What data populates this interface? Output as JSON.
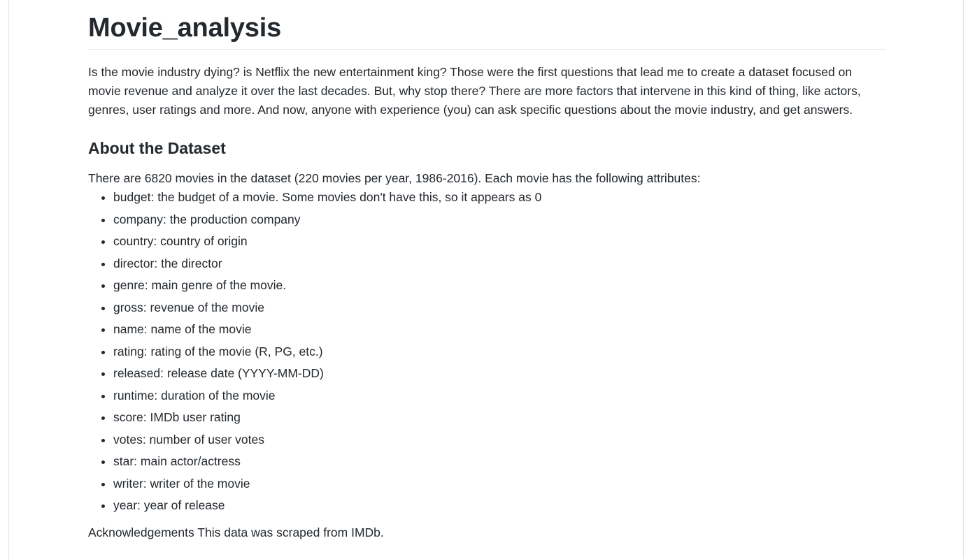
{
  "document": {
    "title": "Movie_analysis",
    "intro": "Is the movie industry dying? is Netflix the new entertainment king? Those were the first questions that lead me to create a dataset focused on movie revenue and analyze it over the last decades. But, why stop there? There are more factors that intervene in this kind of thing, like actors, genres, user ratings and more. And now, anyone with experience (you) can ask specific questions about the movie industry, and get answers.",
    "section_heading": "About the Dataset",
    "dataset_intro": "There are 6820 movies in the dataset (220 movies per year, 1986-2016). Each movie has the following attributes:",
    "attributes": [
      "budget: the budget of a movie. Some movies don't have this, so it appears as 0",
      "company: the production company",
      "country: country of origin",
      "director: the director",
      "genre: main genre of the movie.",
      "gross: revenue of the movie",
      "name: name of the movie",
      "rating: rating of the movie (R, PG, etc.)",
      "released: release date (YYYY-MM-DD)",
      "runtime: duration of the movie",
      "score: IMDb user rating",
      "votes: number of user votes",
      "star: main actor/actress",
      "writer: writer of the movie",
      "year: year of release"
    ],
    "acknowledgements": "Acknowledgements This data was scraped from IMDb."
  }
}
